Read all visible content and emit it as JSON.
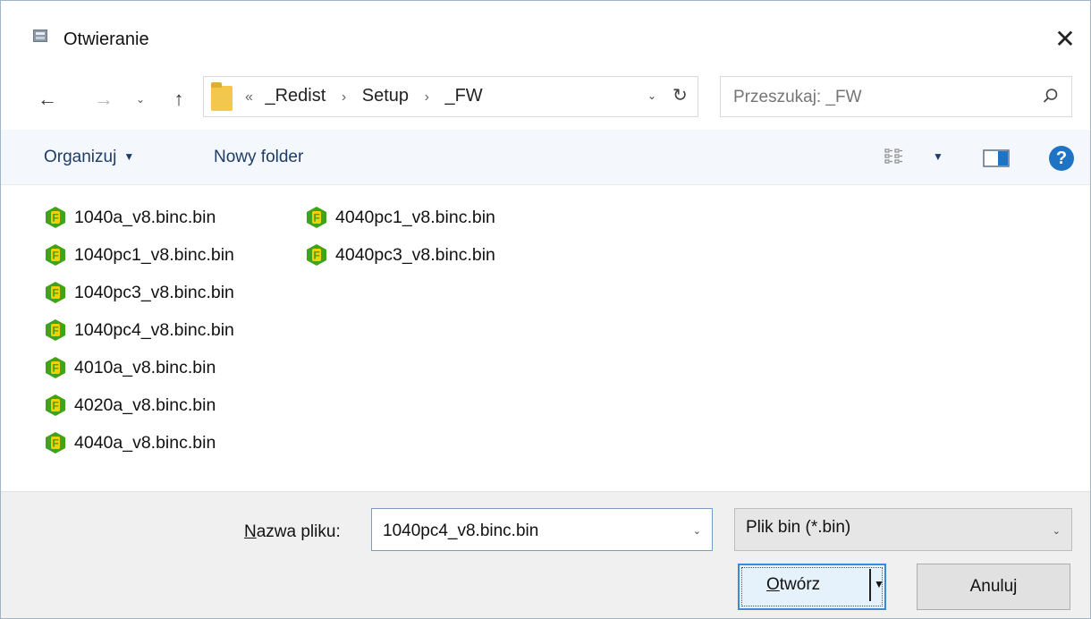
{
  "window": {
    "title": "Otwieranie",
    "close_glyph": "✕"
  },
  "nav": {
    "back_glyph": "←",
    "forward_glyph": "→",
    "recent_glyph": "⌄",
    "up_glyph": "↑",
    "address": {
      "overflow_glyph": "«",
      "crumbs": [
        "_Redist",
        "Setup",
        "_FW"
      ],
      "separator_glyph": "›",
      "dropdown_glyph": "⌄",
      "refresh_glyph": "↻"
    },
    "search": {
      "placeholder": "Przeszukaj: _FW",
      "icon": "search-icon"
    }
  },
  "toolbar": {
    "organize_label": "Organizuj",
    "organize_caret": "▼",
    "new_folder_label": "Nowy folder",
    "view_icon": "view-options-icon",
    "view_caret": "▼",
    "preview_pane_icon": "preview-pane-icon",
    "help_label": "?"
  },
  "files": [
    "1040a_v8.binc.bin",
    "1040pc1_v8.binc.bin",
    "1040pc3_v8.binc.bin",
    "1040pc4_v8.binc.bin",
    "4010a_v8.binc.bin",
    "4020a_v8.binc.bin",
    "4040a_v8.binc.bin",
    "4040pc1_v8.binc.bin",
    "4040pc3_v8.binc.bin"
  ],
  "file_icon": {
    "name": "green-f-file-icon",
    "letter": "F",
    "color": "#3fa41a",
    "accent": "#f2d100"
  },
  "bottom": {
    "filename_label_accel": "N",
    "filename_label_rest": "azwa pliku:",
    "filename_value": "1040pc4_v8.binc.bin",
    "filetype_value": "Plik bin (*.bin)",
    "dropdown_glyph": "⌄",
    "open_label_accel": "O",
    "open_label_rest": "twórz",
    "open_arrow_glyph": "▼",
    "cancel_label": "Anuluj"
  },
  "colors": {
    "accent_blue": "#3c8ad6",
    "help_blue": "#1f73c4",
    "toolbar_text": "#1e3d66",
    "folder_yellow": "#f3c64c"
  }
}
